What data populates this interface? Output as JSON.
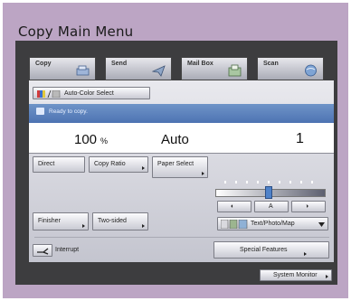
{
  "header": {
    "title": "Copy Main Menu"
  },
  "tabs": [
    {
      "label": "Copy",
      "icon": "copy-icon",
      "active": true
    },
    {
      "label": "Send",
      "icon": "send-icon",
      "active": false
    },
    {
      "label": "Mail Box",
      "icon": "mailbox-icon",
      "active": false
    },
    {
      "label": "Scan",
      "icon": "scan-icon",
      "active": false
    }
  ],
  "color_select": {
    "label": "Auto-Color Select",
    "icon": "color-mode-icon"
  },
  "status": {
    "text": "Ready to copy."
  },
  "display": {
    "ratio": "100",
    "ratio_unit": "%",
    "paper": "Auto",
    "copies": "1"
  },
  "buttons": {
    "direct": "Direct",
    "copy_ratio": "Copy Ratio",
    "paper_select": "Paper Select",
    "finisher": "Finisher",
    "two_sided": "Two-sided",
    "interrupt": "Interrupt",
    "special_features": "Special Features",
    "system_monitor": "System Monitor"
  },
  "density": {
    "left_label": "◐",
    "auto_label": "A",
    "right_label": "◑",
    "level": 0.48
  },
  "original_type": {
    "label": "Text/Photo/Map"
  },
  "colors": {
    "frame": "#bca5c4",
    "screen": "#3d3d3f",
    "status": "#4d73b2",
    "knob": "#4f82c9"
  }
}
